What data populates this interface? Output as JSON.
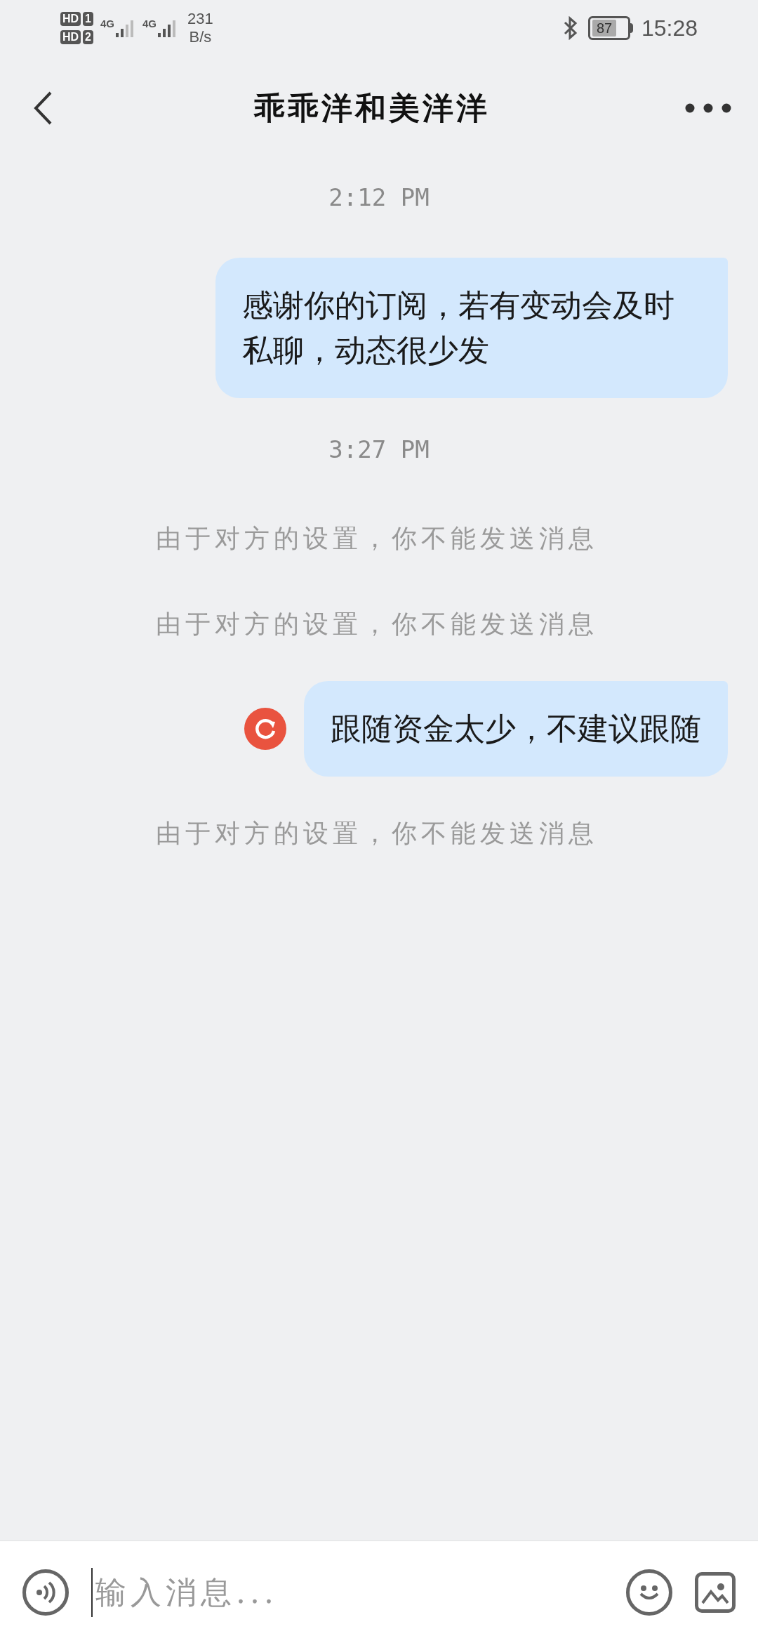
{
  "status_bar": {
    "sim_slots": [
      {
        "badge": "HD",
        "slot": "1",
        "network": "4G"
      },
      {
        "badge": "HD",
        "slot": "2",
        "network": "4G"
      }
    ],
    "speed_value": "231",
    "speed_unit": "B/s",
    "battery": "87",
    "time": "15:28"
  },
  "header": {
    "title": "乖乖洋和美洋洋"
  },
  "messages": [
    {
      "kind": "timestamp",
      "text": "2:12 PM"
    },
    {
      "kind": "sent",
      "text": "感谢你的订阅，若有变动会及时私聊，动态很少发",
      "failed": false
    },
    {
      "kind": "timestamp",
      "text": "3:27 PM"
    },
    {
      "kind": "system",
      "text": "由于对方的设置，你不能发送消息"
    },
    {
      "kind": "system",
      "text": "由于对方的设置，你不能发送消息"
    },
    {
      "kind": "sent",
      "text": "跟随资金太少，不建议跟随",
      "failed": true
    },
    {
      "kind": "system",
      "text": "由于对方的设置，你不能发送消息"
    }
  ],
  "composer": {
    "placeholder": "输入消息..."
  }
}
